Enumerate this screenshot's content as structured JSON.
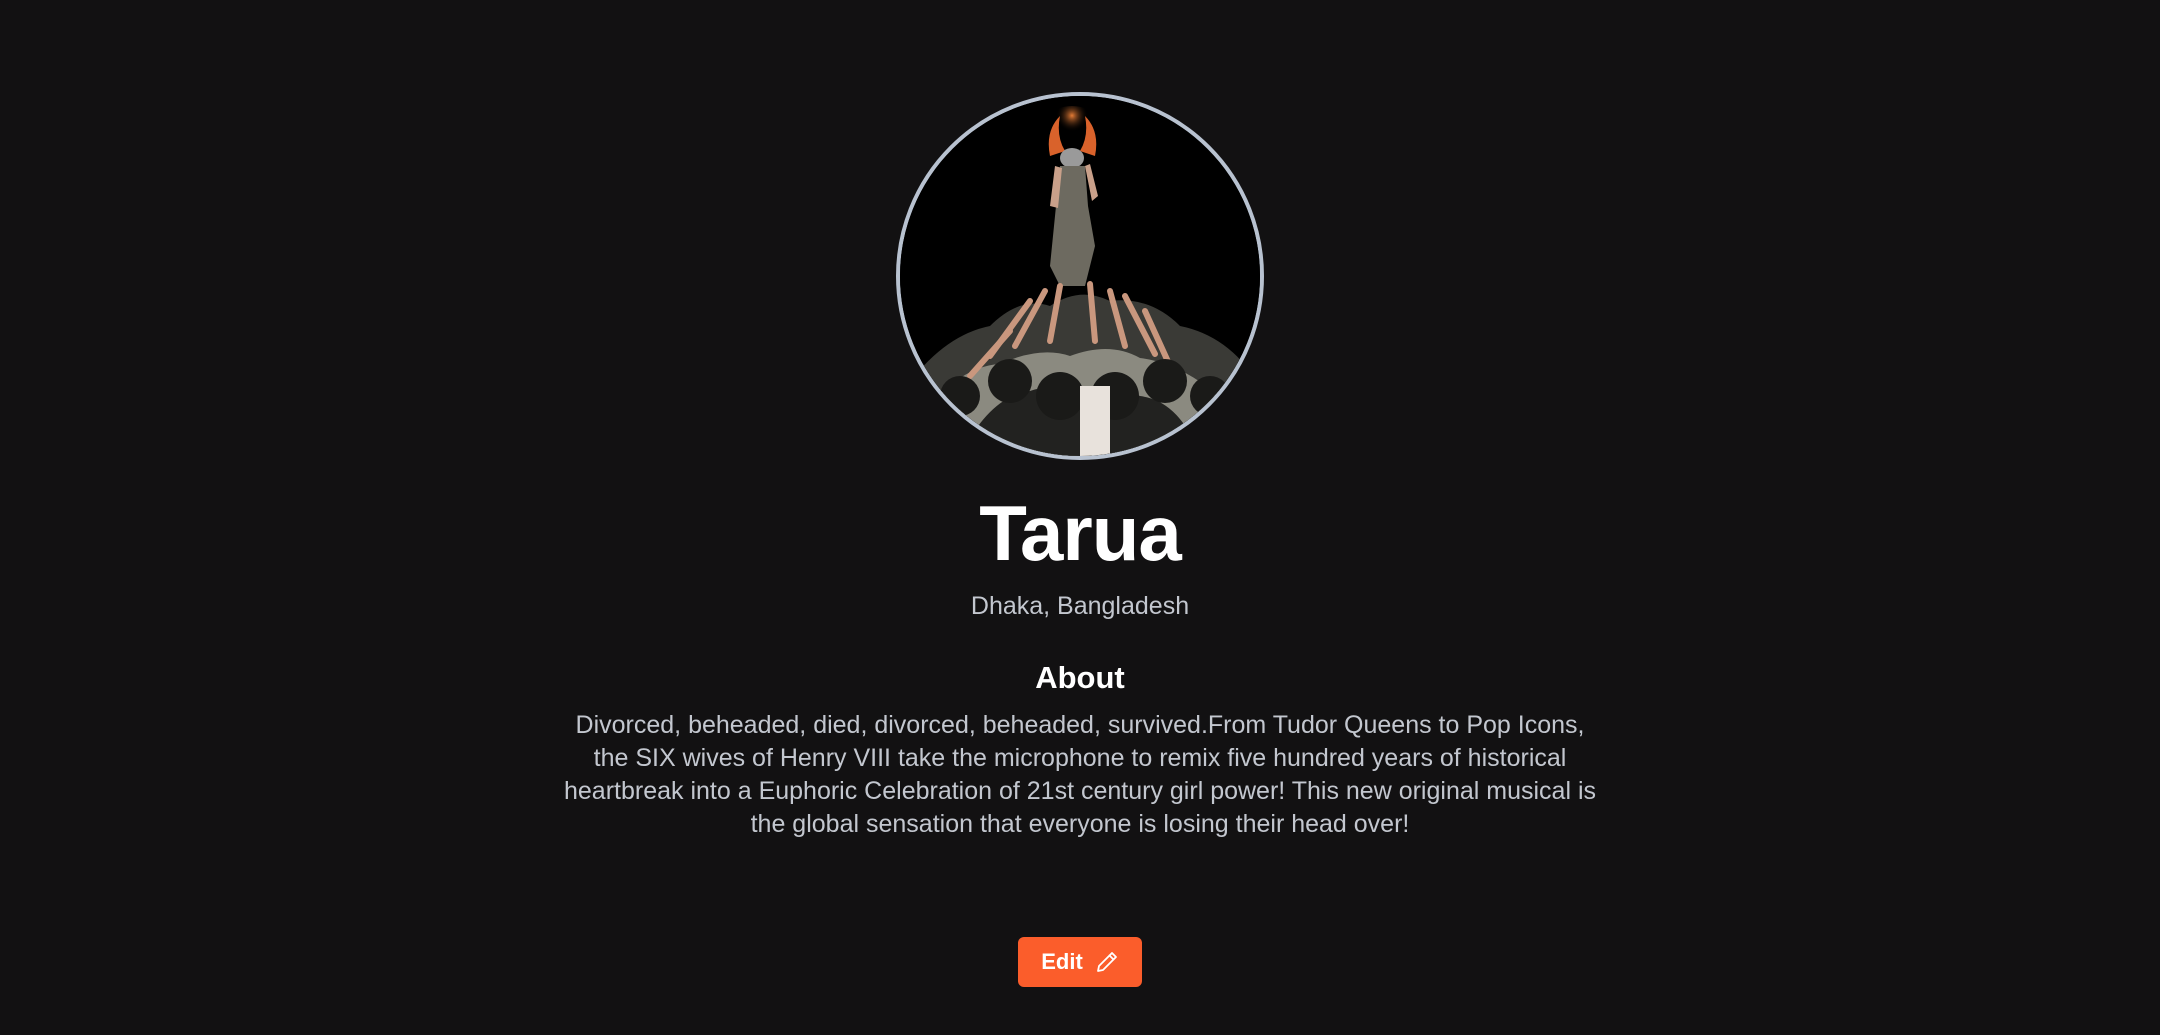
{
  "profile": {
    "name": "Tarua",
    "location": "Dhaka, Bangladesh",
    "avatar_icon": "profile-photo"
  },
  "about": {
    "heading": "About",
    "text": "Divorced, beheaded, died, divorced, beheaded, survived.From Tudor Queens to Pop Icons, the SIX wives of Henry VIII take the microphone to remix five hundred years of historical heartbreak into a Euphoric Celebration of 21st century girl power! This new original musical is the global sensation that everyone is losing their head over!"
  },
  "actions": {
    "edit_label": "Edit",
    "edit_icon": "pencil-icon"
  },
  "colors": {
    "background": "#121112",
    "accent": "#fb5d2b",
    "avatar_border": "#b8c2d0",
    "muted_text": "#c3c7cf"
  }
}
